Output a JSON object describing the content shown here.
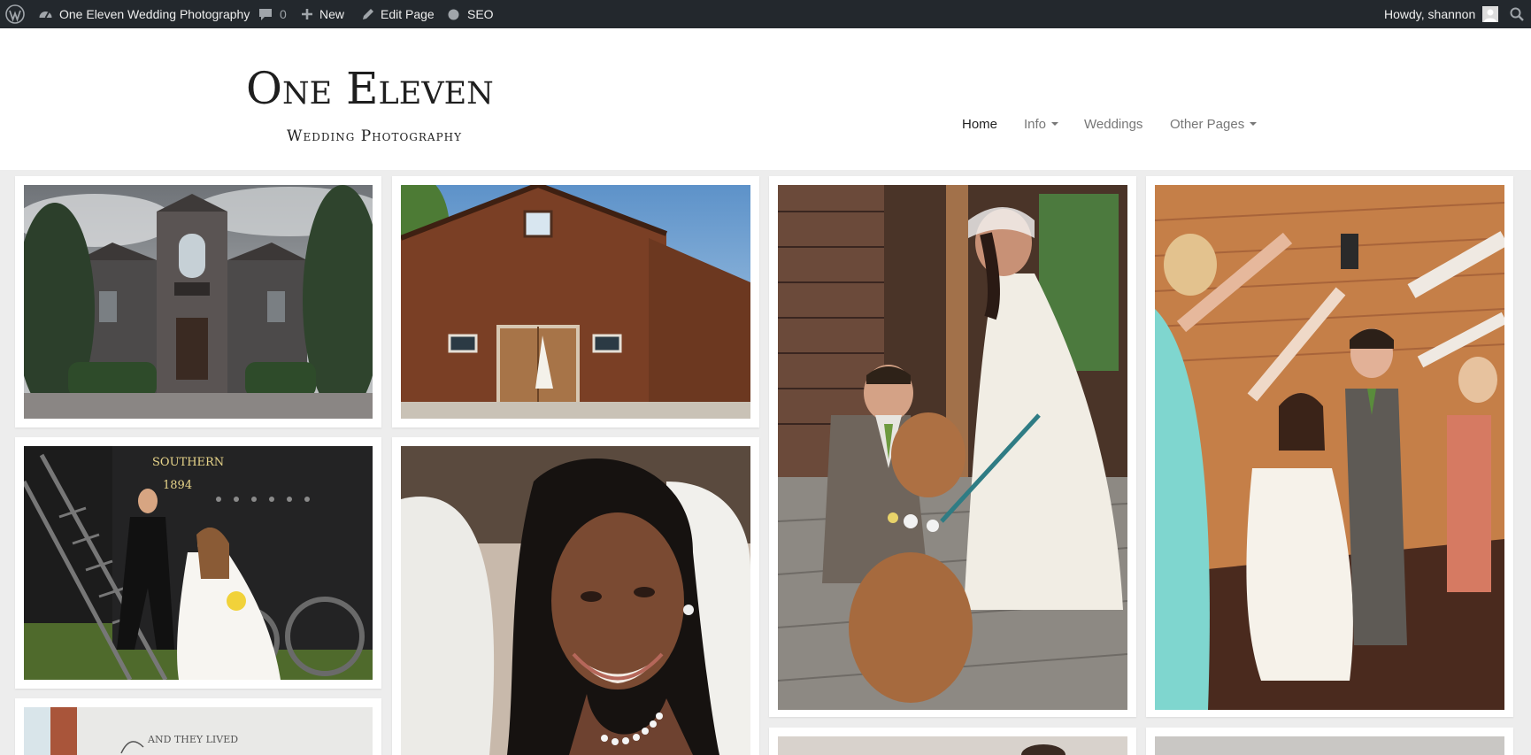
{
  "adminbar": {
    "site_name": "One Eleven Wedding Photography",
    "comments_count": "0",
    "new_label": "New",
    "edit_label": "Edit Page",
    "seo_label": "SEO",
    "greeting": "Howdy, shannon",
    "icons": [
      "wordpress-icon",
      "dashboard-icon",
      "comment-icon",
      "plus-icon",
      "pencil-icon",
      "seo-dot-icon",
      "avatar-icon",
      "search-icon"
    ]
  },
  "logo": {
    "line1": "One Eleven",
    "line2": "Wedding Photography"
  },
  "nav": {
    "home": "Home",
    "info": "Info",
    "weddings": "Weddings",
    "other_pages": "Other Pages"
  },
  "gallery": {
    "photos": [
      {
        "name": "castle-venue-photo",
        "alt": "Stone castle venue with bride on balcony"
      },
      {
        "name": "barn-dress-photo",
        "alt": "Wooden barn with wedding dress hanging on door"
      },
      {
        "name": "couple-dog-photo",
        "alt": "Bride and groom with dog on porch"
      },
      {
        "name": "sparkler-exit-photo",
        "alt": "Couple exiting through arch of guests"
      },
      {
        "name": "train-couple-photo",
        "alt": "Couple on steps of Southern 1894 locomotive"
      },
      {
        "name": "bride-portrait-photo",
        "alt": "Close-up portrait of smiling bride"
      },
      {
        "name": "sign-photo",
        "alt": "And they lived happily ever after sign"
      },
      {
        "name": "partial-photo-1",
        "alt": "Partial photo"
      },
      {
        "name": "partial-photo-2",
        "alt": "Partial photo"
      }
    ],
    "train_text_1": "SOUTHERN",
    "train_text_2": "1894",
    "sign_text": "AND THEY LIVED"
  },
  "colors": {
    "adminbar_bg": "#23282d",
    "page_bg": "#ededed",
    "nav_active": "#222222",
    "nav_muted": "#777777"
  }
}
